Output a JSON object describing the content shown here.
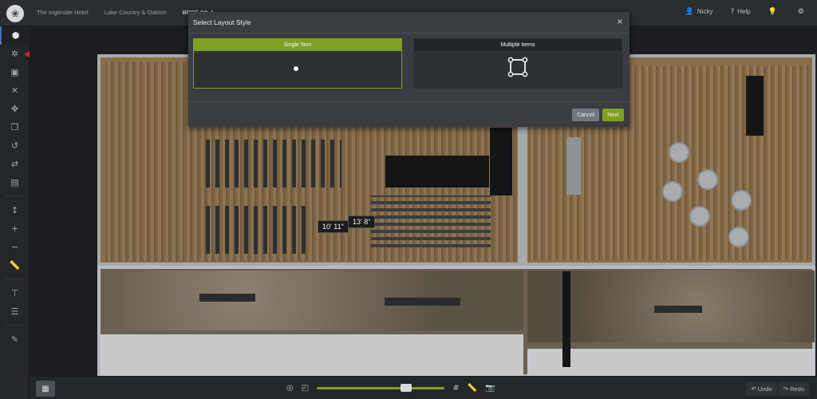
{
  "topbar": {
    "breadcrumbs": [
      "The Ingleside Hotel",
      "Lake Country & Oakton",
      "BRPF 6th A..."
    ],
    "user": "Nicky",
    "help": "Help",
    "user_icon": "user-icon",
    "help_icon": "help-icon",
    "bulb_icon": "lightbulb-icon",
    "settings_icon": "gear-icon"
  },
  "sidebar": {
    "items": [
      "cube-icon",
      "bug-icon",
      "select-box-icon",
      "close-icon",
      "move-icon",
      "copy-icon",
      "rotate-icon",
      "swap-icon",
      "list-icon",
      "resize-vertical-icon",
      "plus-icon",
      "minus-icon",
      "ruler-icon",
      "align-top-icon",
      "align-rows-icon",
      "edit-icon"
    ]
  },
  "floorplan": {
    "measurements": [
      "10' 11\"",
      "13' 8\""
    ]
  },
  "modal": {
    "title": "Select Layout Style",
    "close": "×",
    "options": [
      {
        "label": "Single Item",
        "selected": true
      },
      {
        "label": "Multiple Items",
        "selected": false
      }
    ],
    "cancel_label": "Cancel",
    "next_label": "Next"
  },
  "bottombar": {
    "undo_label": "Undo",
    "redo_label": "Redo",
    "zoom_level": 0.72
  },
  "colors": {
    "accent": "#7fa020",
    "arrow": "#e0201a"
  }
}
